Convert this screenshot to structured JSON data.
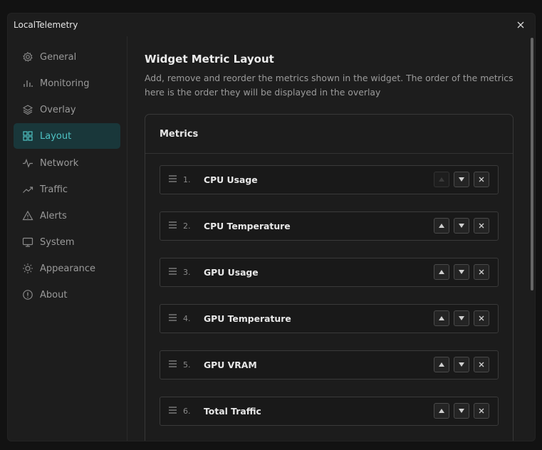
{
  "app": {
    "title": "LocalTelemetry"
  },
  "sidebar": {
    "items": [
      {
        "label": "General",
        "icon": "gear-icon"
      },
      {
        "label": "Monitoring",
        "icon": "bar-chart-icon"
      },
      {
        "label": "Overlay",
        "icon": "layers-icon"
      },
      {
        "label": "Layout",
        "icon": "grid-icon",
        "active": true
      },
      {
        "label": "Network",
        "icon": "pulse-icon"
      },
      {
        "label": "Traffic",
        "icon": "trend-icon"
      },
      {
        "label": "Alerts",
        "icon": "warning-icon"
      },
      {
        "label": "System",
        "icon": "monitor-icon"
      },
      {
        "label": "Appearance",
        "icon": "sun-icon"
      },
      {
        "label": "About",
        "icon": "info-icon"
      }
    ]
  },
  "main": {
    "title": "Widget Metric Layout",
    "description": "Add, remove and reorder the metrics shown in the widget. The order of the metrics here is the order they will be displayed in the overlay",
    "card": {
      "title": "Metrics",
      "metrics": [
        {
          "index": "1.",
          "name": "CPU Usage"
        },
        {
          "index": "2.",
          "name": "CPU Temperature"
        },
        {
          "index": "3.",
          "name": "GPU Usage"
        },
        {
          "index": "4.",
          "name": "GPU Temperature"
        },
        {
          "index": "5.",
          "name": "GPU VRAM"
        },
        {
          "index": "6.",
          "name": "Total Traffic"
        }
      ]
    }
  },
  "colors": {
    "accent": "#4fc3c4",
    "active_bg": "#19373a",
    "window_bg": "#1d1d1d"
  }
}
